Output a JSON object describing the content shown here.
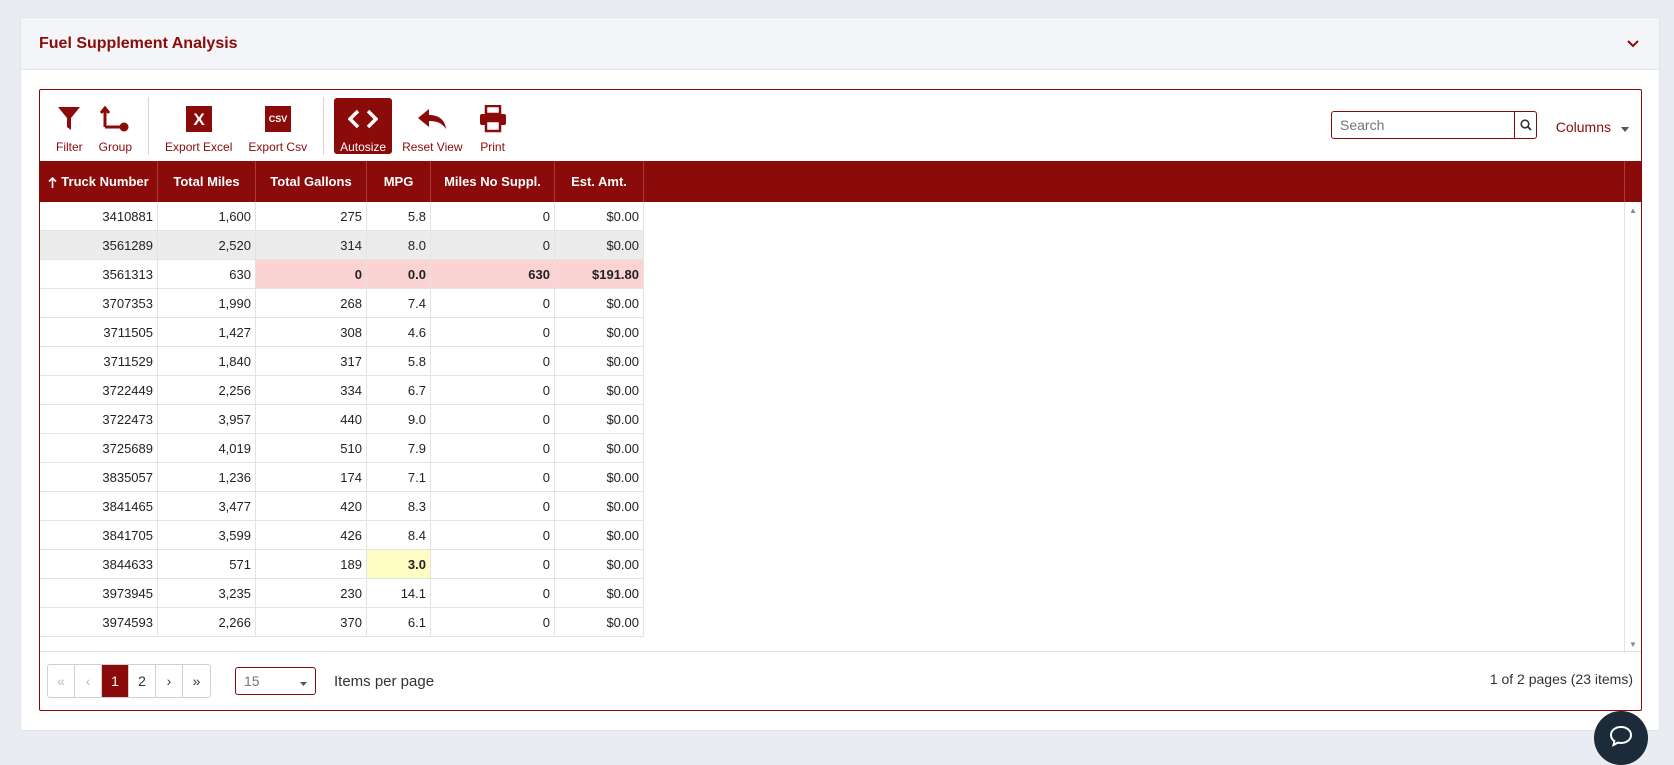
{
  "card": {
    "title": "Fuel Supplement Analysis"
  },
  "toolbar": {
    "filter": "Filter",
    "group": "Group",
    "export_excel": "Export Excel",
    "export_csv": "Export Csv",
    "export_csv_icon_text": "CSV",
    "export_excel_icon_text": "X",
    "autosize": "Autosize",
    "reset_view": "Reset View",
    "print": "Print",
    "search_placeholder": "Search",
    "columns": "Columns"
  },
  "columns": [
    "Truck Number",
    "Total Miles",
    "Total Gallons",
    "MPG",
    "Miles No Suppl.",
    "Est. Amt."
  ],
  "sort": {
    "column": "Truck Number",
    "direction": "ascending"
  },
  "rows": [
    [
      "3410881",
      "1,600",
      "275",
      "5.8",
      "0",
      "$0.00"
    ],
    [
      "3561289",
      "2,520",
      "314",
      "8.0",
      "0",
      "$0.00"
    ],
    [
      "3561313",
      "630",
      "0",
      "0.0",
      "630",
      "$191.80"
    ],
    [
      "3707353",
      "1,990",
      "268",
      "7.4",
      "0",
      "$0.00"
    ],
    [
      "3711505",
      "1,427",
      "308",
      "4.6",
      "0",
      "$0.00"
    ],
    [
      "3711529",
      "1,840",
      "317",
      "5.8",
      "0",
      "$0.00"
    ],
    [
      "3722449",
      "2,256",
      "334",
      "6.7",
      "0",
      "$0.00"
    ],
    [
      "3722473",
      "3,957",
      "440",
      "9.0",
      "0",
      "$0.00"
    ],
    [
      "3725689",
      "4,019",
      "510",
      "7.9",
      "0",
      "$0.00"
    ],
    [
      "3835057",
      "1,236",
      "174",
      "7.1",
      "0",
      "$0.00"
    ],
    [
      "3841465",
      "3,477",
      "420",
      "8.3",
      "0",
      "$0.00"
    ],
    [
      "3841705",
      "3,599",
      "426",
      "8.4",
      "0",
      "$0.00"
    ],
    [
      "3844633",
      "571",
      "189",
      "3.0",
      "0",
      "$0.00"
    ],
    [
      "3973945",
      "3,235",
      "230",
      "14.1",
      "0",
      "$0.00"
    ],
    [
      "3974593",
      "2,266",
      "370",
      "6.1",
      "0",
      "$0.00"
    ]
  ],
  "pager": {
    "first": "«",
    "prev": "‹",
    "pages": [
      "1",
      "2"
    ],
    "next": "›",
    "last": "»",
    "current": "1",
    "per_page": "15",
    "per_page_label": "Items per page",
    "info": "1 of 2 pages (23 items)"
  },
  "colors": {
    "accent": "#8b0a0a",
    "danger_bg": "#fbd3d3",
    "warning_bg": "#fdfcc3",
    "hover_row": "#ececec"
  }
}
